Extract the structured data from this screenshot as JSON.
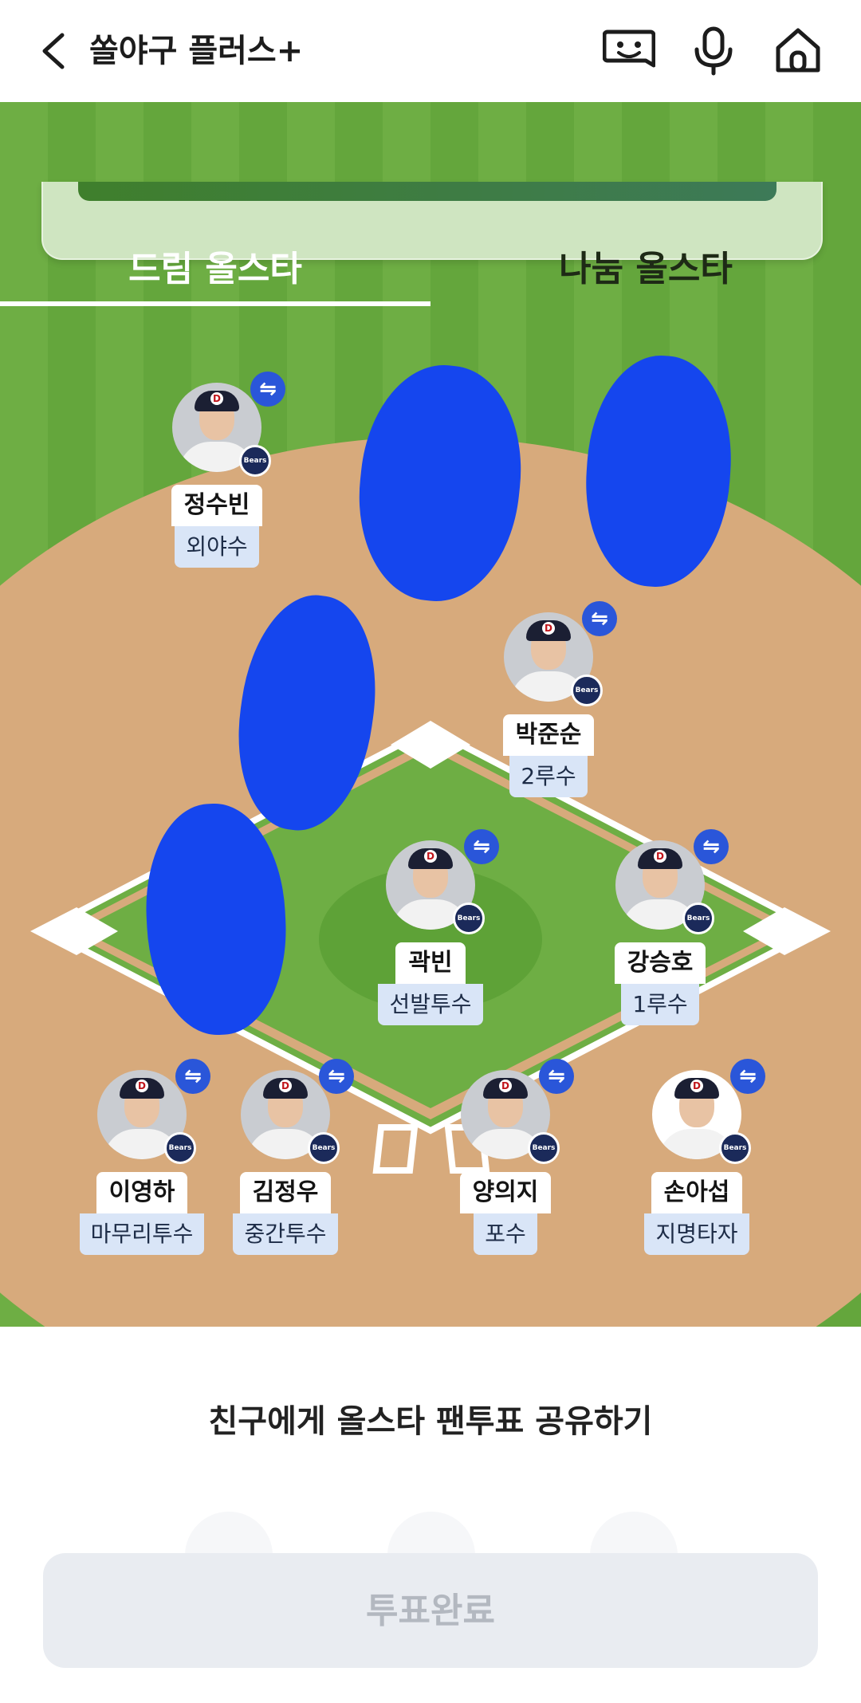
{
  "header": {
    "title": "쏠야구 플러스+",
    "icons": [
      "back-icon",
      "chat-bot-icon",
      "microphone-icon",
      "home-icon"
    ]
  },
  "tabs": [
    {
      "label": "드림 올스타",
      "active": true
    },
    {
      "label": "나눔 올스타",
      "active": false
    }
  ],
  "players": [
    {
      "name": "정수빈",
      "position": "외야수"
    },
    {
      "name": "박준순",
      "position": "2루수"
    },
    {
      "name": "곽빈",
      "position": "선발투수"
    },
    {
      "name": "강승호",
      "position": "1루수"
    },
    {
      "name": "이영하",
      "position": "마무리투수"
    },
    {
      "name": "김정우",
      "position": "중간투수"
    },
    {
      "name": "양의지",
      "position": "포수"
    },
    {
      "name": "손아섭",
      "position": "지명타자"
    }
  ],
  "swap_symbol": "⇋",
  "cap_letter": "D",
  "share": {
    "label": "친구에게 올스타 팬투표 공유하기"
  },
  "vote_button": {
    "label": "투표완료",
    "enabled": false
  },
  "colors": {
    "field_green": "#6eae44",
    "infield_dirt": "#d7aa7c",
    "swap_blue": "#2a56d9",
    "scribble_blue": "#1546ee"
  }
}
